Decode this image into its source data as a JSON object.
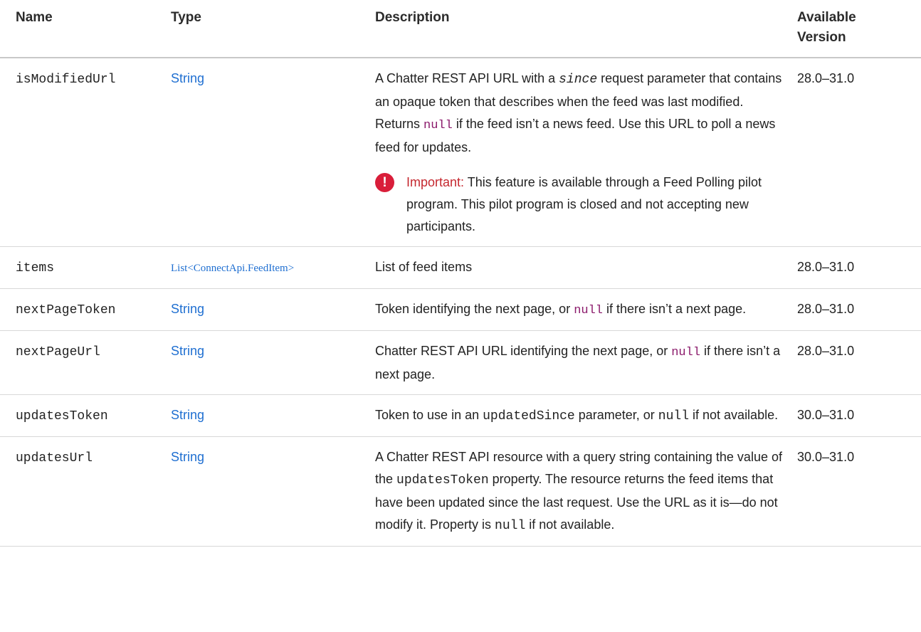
{
  "headers": {
    "name": "Name",
    "type": "Type",
    "description": "Description",
    "version_line1": "Available",
    "version_line2": "Version"
  },
  "rows": [
    {
      "name": "isModifiedUrl",
      "type": "String",
      "desc_a": "A Chatter REST API URL with a ",
      "desc_code1": "since",
      "desc_b": " request parameter that contains an opaque token that describes when the feed was last modified. Returns ",
      "desc_code2": "null",
      "desc_c": " if the feed isn’t a news feed. Use this URL to poll a news feed for updates.",
      "note_icon": "!",
      "note_label": "Important:",
      "note_text": " This feature is available through a Feed Polling pilot program. This pilot program is closed and not accepting new participants.",
      "version": "28.0–31.0"
    },
    {
      "name": "items",
      "type_prefix": "List<",
      "type_link": "ConnectApi.FeedItem",
      "type_suffix": ">",
      "desc": "List of feed items",
      "version": "28.0–31.0"
    },
    {
      "name": "nextPageToken",
      "type": "String",
      "desc_a": "Token identifying the next page, or ",
      "desc_code": "null",
      "desc_b": " if there isn’t a next page.",
      "version": "28.0–31.0"
    },
    {
      "name": "nextPageUrl",
      "type": "String",
      "desc_a": "Chatter REST API URL identifying the next page, or ",
      "desc_code": "null",
      "desc_b": " if there isn’t a next page.",
      "version": "28.0–31.0"
    },
    {
      "name": "updatesToken",
      "type": "String",
      "desc_a": "Token to use in an ",
      "desc_code1": "updatedSince",
      "desc_b": " parameter, or ",
      "desc_code2": "null",
      "desc_c": " if not available.",
      "version": "30.0–31.0"
    },
    {
      "name": "updatesUrl",
      "type": "String",
      "desc_a": "A Chatter REST API resource with a query string containing the value of the ",
      "desc_code1": "updatesToken",
      "desc_b": " property. The resource returns the feed items that have been updated since the last request. Use the URL as it is—do not modify it. Property is ",
      "desc_code2": "null",
      "desc_c": " if not available.",
      "version": "30.0–31.0"
    }
  ],
  "colors": {
    "link": "#1f6fd1",
    "important_icon": "#d91e3a",
    "important_label": "#c5282f",
    "code_highlight": "#8b1a6b"
  },
  "icons": {
    "important": "exclamation-circle-icon"
  }
}
